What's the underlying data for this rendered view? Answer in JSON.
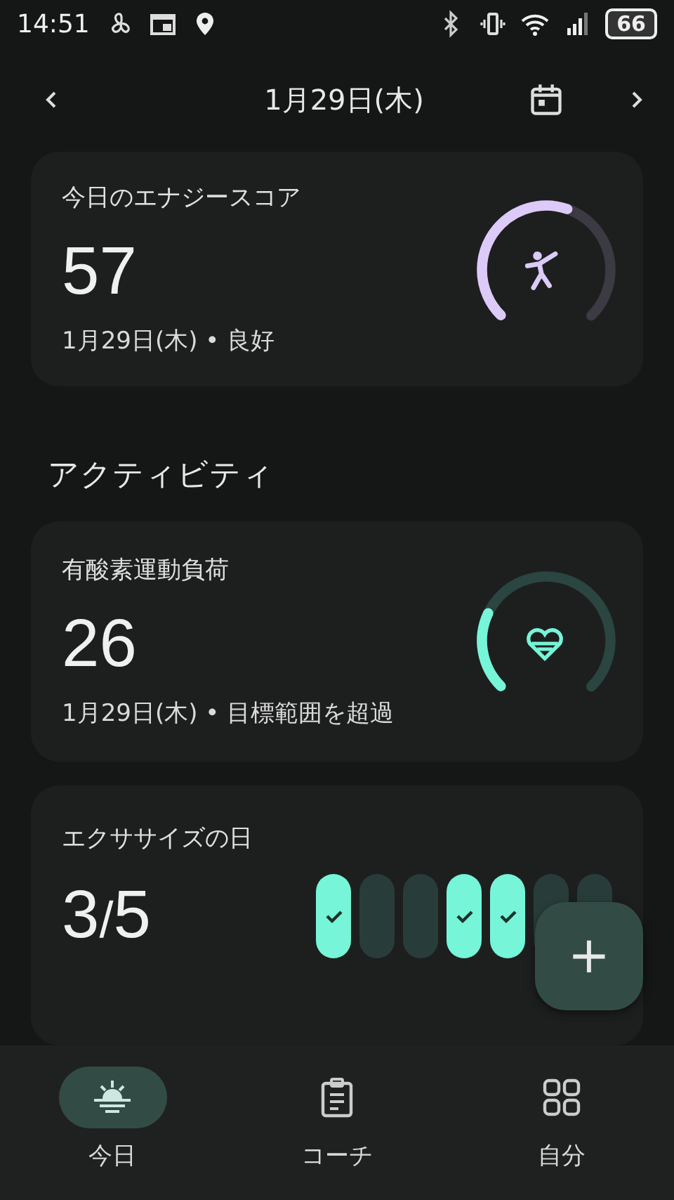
{
  "status_bar": {
    "time": "14:51",
    "battery": "66"
  },
  "header": {
    "date": "1月29日(木)"
  },
  "energy_card": {
    "title": "今日のエナジースコア",
    "score": "57",
    "subtitle": "1月29日(木) • 良好",
    "level": 0.57
  },
  "section_title": "アクティビティ",
  "cardio_card": {
    "title": "有酸素運動負荷",
    "score": "26",
    "subtitle": "1月29日(木) • 目標範囲を超過",
    "level": 0.26
  },
  "exercise_card": {
    "title": "エクササイズの日",
    "done": "3",
    "separator": "/",
    "goal": "5",
    "days": [
      {
        "checked": true
      },
      {
        "checked": false
      },
      {
        "checked": false
      },
      {
        "checked": true
      },
      {
        "checked": true
      },
      {
        "checked": false
      },
      {
        "checked": false
      }
    ]
  },
  "fab": {
    "label": "+"
  },
  "bottom_nav": [
    {
      "label": "今日",
      "selected": true
    },
    {
      "label": "コーチ",
      "selected": false
    },
    {
      "label": "自分",
      "selected": false
    }
  ]
}
